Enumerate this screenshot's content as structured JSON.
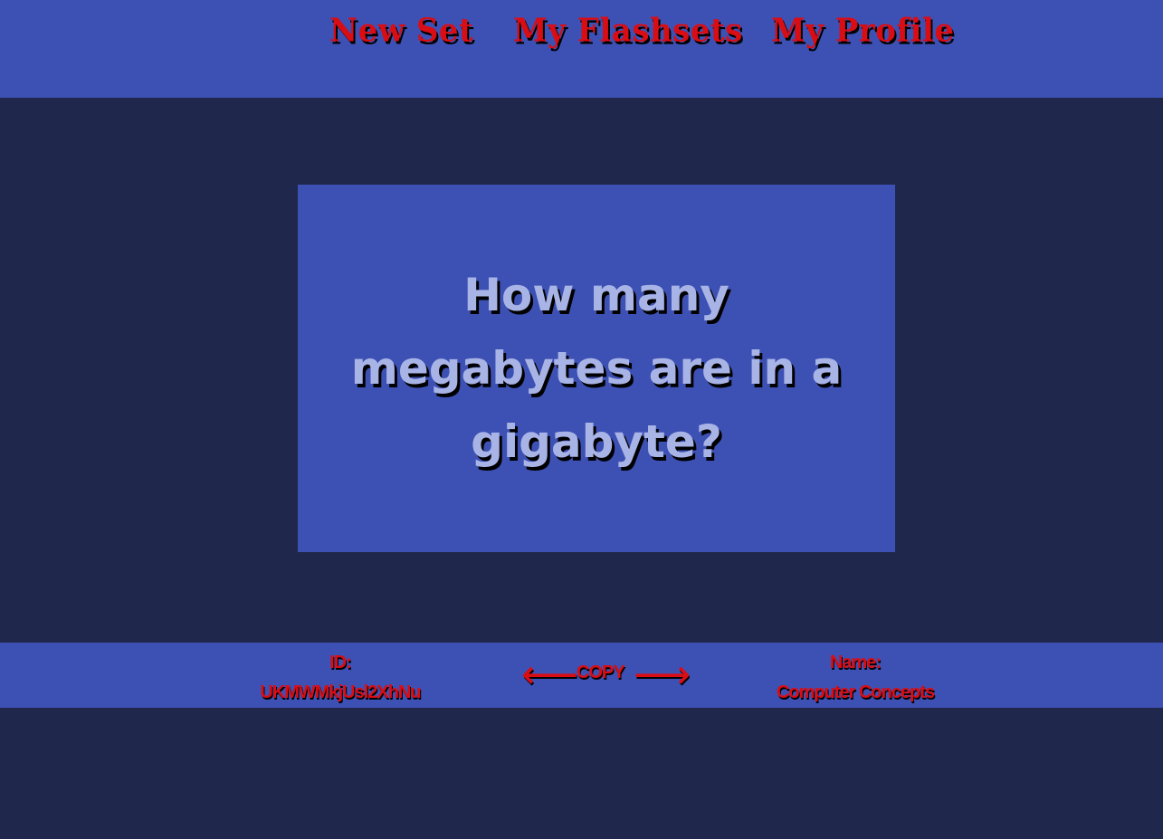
{
  "nav": {
    "new_set": "New Set",
    "my_flashsets": "My Flashsets",
    "my_profile": "My Profile"
  },
  "card": {
    "text": "How many megabytes are in a gigabyte?"
  },
  "footer": {
    "id_label": "ID:",
    "id_value": "UKMWMkjUsl2XhNu",
    "prev_arrow": "⟵",
    "copy_label": "COPY",
    "next_arrow": "⟶",
    "name_label": "Name:",
    "name_value": "Computer Concepts"
  },
  "colors": {
    "page_background": "#1f284c",
    "panel_background": "#3d51b4",
    "accent_text": "#d90d14",
    "card_text": "#a9b4e6"
  }
}
